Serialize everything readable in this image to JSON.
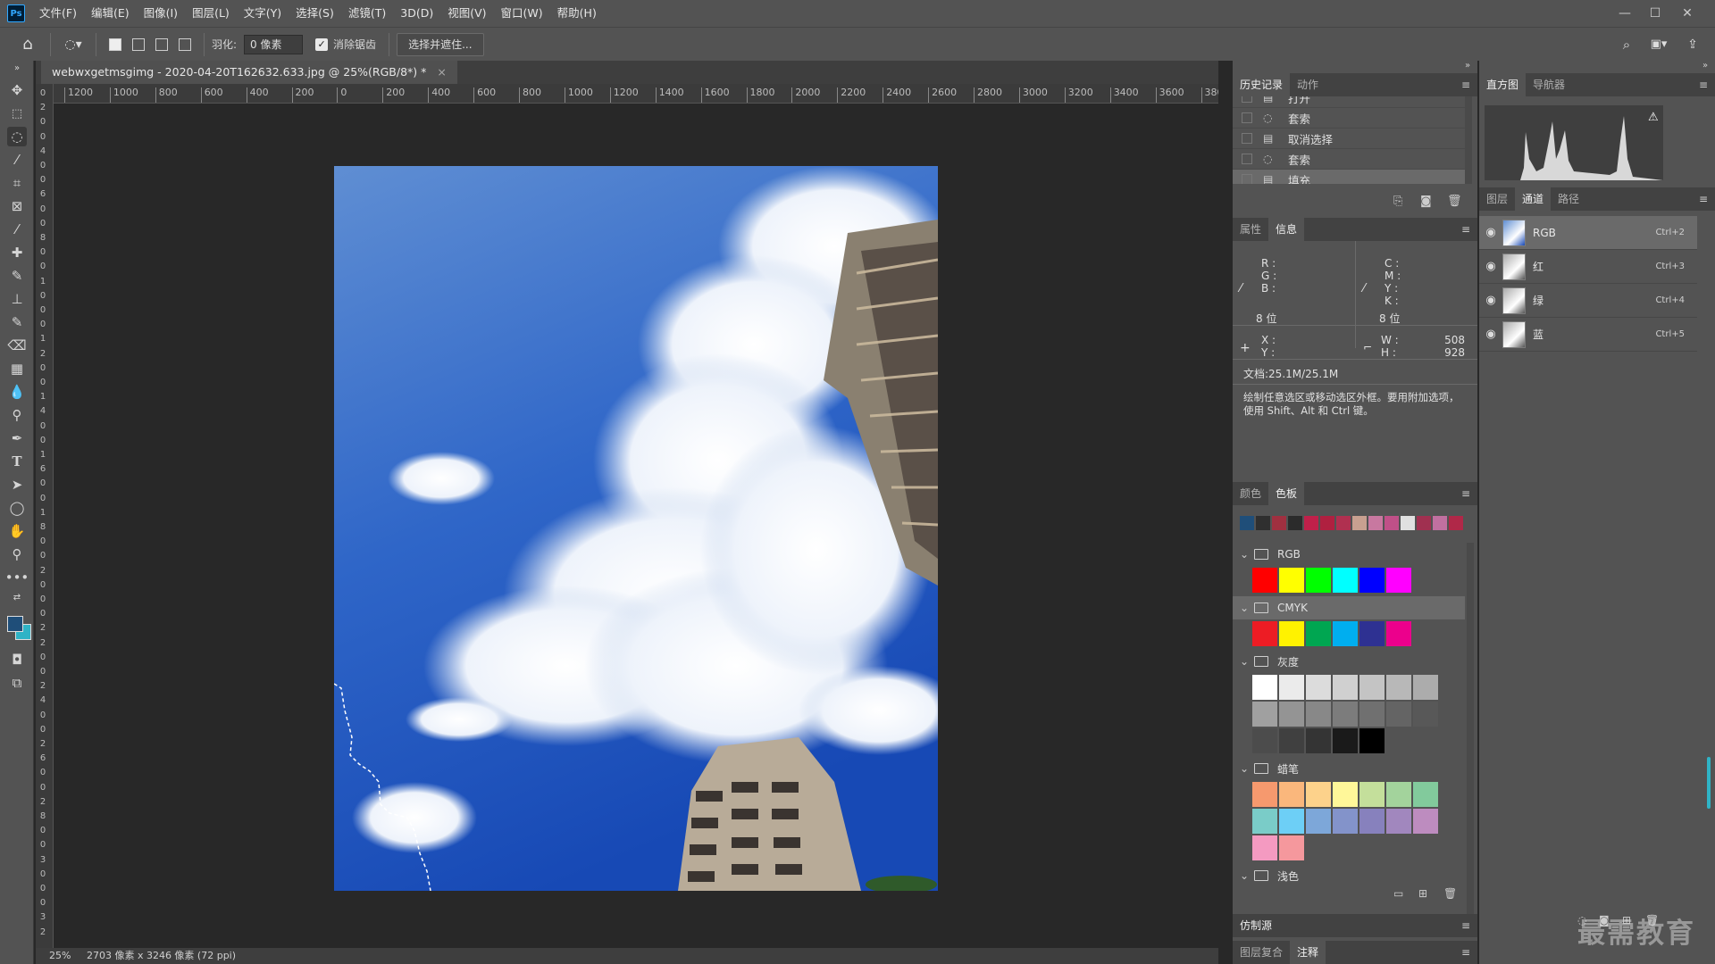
{
  "app": {
    "logo": "Ps"
  },
  "menu": [
    "文件(F)",
    "编辑(E)",
    "图像(I)",
    "图层(L)",
    "文字(Y)",
    "选择(S)",
    "滤镜(T)",
    "3D(D)",
    "视图(V)",
    "窗口(W)",
    "帮助(H)"
  ],
  "options": {
    "feather_label": "羽化:",
    "feather_value": "0 像素",
    "antialias_label": "消除锯齿",
    "antialias_checked": true,
    "select_mask_label": "选择并遮住..."
  },
  "document": {
    "tab_title": "webwxgetmsgimg - 2020-04-20T162632.633.jpg @ 25%(RGB/8*) *",
    "close_icon": "close-icon"
  },
  "ruler_h": [
    "1200",
    "1000",
    "800",
    "600",
    "400",
    "200",
    "0",
    "200",
    "400",
    "600",
    "800",
    "1000",
    "1200",
    "1400",
    "1600",
    "1800",
    "2000",
    "2200",
    "2400",
    "2600",
    "2800",
    "3000",
    "3200",
    "3400",
    "3600",
    "3800"
  ],
  "ruler_v": [
    "0",
    "2",
    "0",
    "0",
    "4",
    "0",
    "0",
    "6",
    "0",
    "0",
    "8",
    "0",
    "0",
    "1",
    "0",
    "0",
    "0",
    "1",
    "2",
    "0",
    "0",
    "1",
    "4",
    "0",
    "0",
    "1",
    "6",
    "0",
    "0",
    "1",
    "8",
    "0",
    "0",
    "2",
    "0",
    "0",
    "0",
    "2",
    "2",
    "0",
    "0",
    "2",
    "4",
    "0",
    "0",
    "2",
    "6",
    "0",
    "0",
    "2",
    "8",
    "0",
    "0",
    "3",
    "0",
    "0",
    "0",
    "3",
    "2"
  ],
  "status": {
    "zoom": "25%",
    "doc_size": "2703 像素 x 3246 像素 (72 ppi)"
  },
  "history": {
    "tabs": [
      "历史记录",
      "动作"
    ],
    "items": [
      {
        "label": "打开",
        "icon": "document-icon"
      },
      {
        "label": "套索",
        "icon": "lasso-icon"
      },
      {
        "label": "取消选择",
        "icon": "document-icon"
      },
      {
        "label": "套索",
        "icon": "lasso-icon"
      },
      {
        "label": "填充",
        "icon": "document-icon",
        "selected": true
      }
    ]
  },
  "info": {
    "tabs": [
      "属性",
      "信息"
    ],
    "rgb_labels": [
      "R :",
      "G :",
      "B :"
    ],
    "cmyk_labels": [
      "C :",
      "M :",
      "Y :",
      "K :"
    ],
    "bit_left": "8 位",
    "bit_right": "8 位",
    "x_label": "X :",
    "y_label": "Y :",
    "w_label": "W :",
    "h_label": "H :",
    "w_value": "508",
    "h_value": "928",
    "doc_info": "文档:25.1M/25.1M",
    "hint": "绘制任意选区或移动选区外框。要用附加选项，使用 Shift、Alt 和 Ctrl 键。"
  },
  "swatches": {
    "tabs": [
      "颜色",
      "色板"
    ],
    "recent": [
      "#1f4e79",
      "#2f2f2f",
      "#a03040",
      "#2b2b2b",
      "#c0204a",
      "#b02040",
      "#b03050",
      "#c8a090",
      "#c878a0",
      "#c05088",
      "#e0e0e0",
      "#a03050",
      "#c070a0",
      "#b02848"
    ],
    "groups": [
      {
        "name": "RGB",
        "colors": [
          "#ff0000",
          "#ffff00",
          "#00ff00",
          "#00ffff",
          "#0000ff",
          "#ff00ff"
        ]
      },
      {
        "name": "CMYK",
        "colors": [
          "#ed1c24",
          "#fff200",
          "#00a651",
          "#00aeef",
          "#2e3192",
          "#ec008c"
        ]
      },
      {
        "name": "灰度",
        "colors": [
          "#ffffff",
          "#ebebeb",
          "#dcdcdc",
          "#d0d0d0",
          "#c4c4c4",
          "#b8b8b8",
          "#acacac",
          "#a0a0a0",
          "#949494",
          "#888888",
          "#7c7c7c",
          "#707070",
          "#646464",
          "#585858",
          "#4c4c4c",
          "#404040",
          "#343434",
          "#1a1a1a",
          "#000000"
        ]
      },
      {
        "name": "蜡笔",
        "colors": [
          "#f6996e",
          "#fab77c",
          "#fdd28b",
          "#fff799",
          "#c4df9b",
          "#a3d39c",
          "#82ca9c",
          "#7accc8",
          "#6dcff6",
          "#7da7d9",
          "#8393ca",
          "#8781bd",
          "#a187be",
          "#bd8cbf",
          "#f49ac1",
          "#f5989d"
        ]
      },
      {
        "name": "浅色",
        "colors": []
      }
    ]
  },
  "clone_source": {
    "label": "仿制源"
  },
  "bottom_tabs": [
    "图层复合",
    "注释"
  ],
  "histogram": {
    "tabs": [
      "直方图",
      "导航器"
    ],
    "warning_icon": "warning-icon"
  },
  "channels": {
    "tabs": [
      "图层",
      "通道",
      "路径"
    ],
    "items": [
      {
        "name": "RGB",
        "shortcut": "Ctrl+2"
      },
      {
        "name": "红",
        "shortcut": "Ctrl+3"
      },
      {
        "name": "绿",
        "shortcut": "Ctrl+4"
      },
      {
        "name": "蓝",
        "shortcut": "Ctrl+5"
      }
    ]
  },
  "watermark": "最需教育",
  "colors": {
    "fg": "#1f4e79",
    "bg": "#2fb3c6",
    "accent": "#31a8ff"
  }
}
